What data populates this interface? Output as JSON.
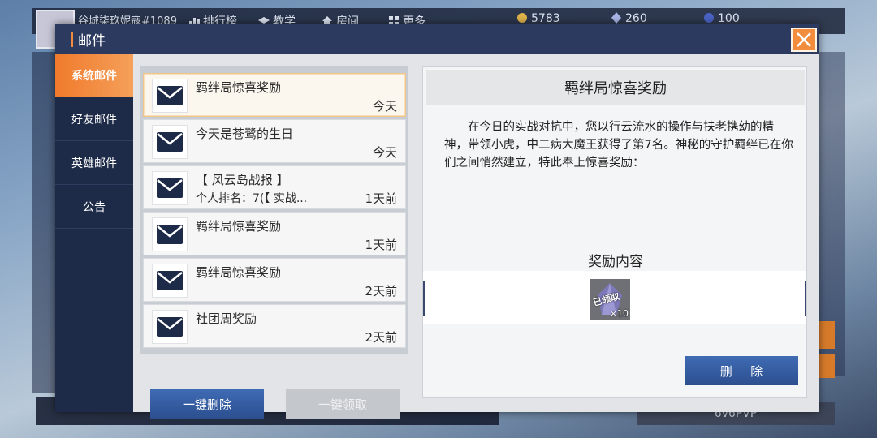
{
  "background": {
    "player_name": "谷城柒玖妮寇#1089",
    "nav": [
      "排行榜",
      "教学",
      "房间",
      "更多"
    ],
    "currencies": [
      {
        "icon": "gold-coin-icon",
        "value": "5783"
      },
      {
        "icon": "crystal-icon",
        "value": "260"
      },
      {
        "icon": "ticket-icon",
        "value": "100"
      }
    ],
    "pvp_label": "6v6PVP"
  },
  "mail": {
    "title": "邮件",
    "tabs": [
      {
        "label": "系统邮件",
        "active": true
      },
      {
        "label": "好友邮件",
        "active": false
      },
      {
        "label": "英雄邮件",
        "active": false
      },
      {
        "label": "公告",
        "active": false
      }
    ],
    "items": [
      {
        "title": "羁绊局惊喜奖励",
        "subtitle": "",
        "time": "今天"
      },
      {
        "title": "今天是苍鹭的生日",
        "subtitle": "",
        "time": "今天"
      },
      {
        "title": "【 风云岛战报 】",
        "subtitle": "个人排名：7(【 实战...",
        "time": "1天前"
      },
      {
        "title": "羁绊局惊喜奖励",
        "subtitle": "",
        "time": "1天前"
      },
      {
        "title": "羁绊局惊喜奖励",
        "subtitle": "",
        "time": "2天前"
      },
      {
        "title": "社团周奖励",
        "subtitle": "",
        "time": "2天前"
      }
    ],
    "buttons": {
      "delete_all": "一键删除",
      "claim_all": "一键领取"
    },
    "detail": {
      "title": "羁绊局惊喜奖励",
      "body": "在今日的实战对抗中，您以行云流水的操作与扶老携幼的精神，带领小虎，中二病大魔王获得了第7名。神秘的守护羁绊已在你们之间悄然建立，特此奉上惊喜奖励：",
      "reward_label": "奖励内容",
      "reward": {
        "icon": "crystal-icon",
        "status": "已领取",
        "quantity": "×10"
      },
      "delete_label": "删除"
    }
  },
  "colors": {
    "accent": "#f08a3c",
    "dialog": "#1f2c4a",
    "button_blue": "#2c4f8f"
  }
}
